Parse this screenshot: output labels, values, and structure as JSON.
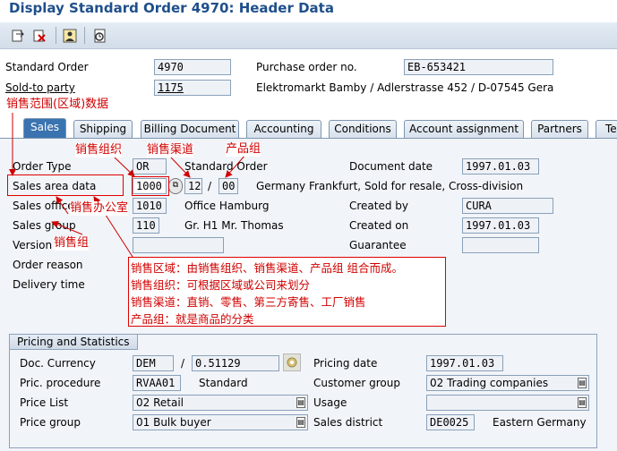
{
  "title": "Display Standard Order 4970: Header Data",
  "header": {
    "standard_order_label": "Standard Order",
    "standard_order_value": "4970",
    "po_label": "Purchase order no.",
    "po_value": "EB-653421",
    "sold_to_label": "Sold-to party",
    "sold_to_value": "1175",
    "sold_to_desc": "Elektromarkt Bamby / Adlerstrasse 452 / D-07545 Gera"
  },
  "tabs": [
    {
      "label": "Sales"
    },
    {
      "label": "Shipping"
    },
    {
      "label": "Billing Document"
    },
    {
      "label": "Accounting"
    },
    {
      "label": "Conditions"
    },
    {
      "label": "Account assignment"
    },
    {
      "label": "Partners"
    },
    {
      "label": "Te"
    }
  ],
  "sales": {
    "order_type_label": "Order Type",
    "order_type_value": "OR",
    "order_type_desc": "Standard Order",
    "doc_date_label": "Document date",
    "doc_date_value": "1997.01.03",
    "sales_area_label": "Sales area data",
    "sales_org": "1000",
    "dist_channel": "12",
    "sep": "/",
    "division": "00",
    "sales_area_desc": "Germany Frankfurt, Sold for resale, Cross-division",
    "sales_office_label": "Sales office",
    "sales_office_value": "1010",
    "sales_office_desc": "Office Hamburg",
    "created_by_label": "Created by",
    "created_by_value": "CURA",
    "sales_group_label": "Sales group",
    "sales_group_value": "110",
    "sales_group_desc": "Gr. H1 Mr. Thomas",
    "created_on_label": "Created on",
    "created_on_value": "1997.01.03",
    "version_label": "Version",
    "guarantee_label": "Guarantee",
    "order_reason_label": "Order reason",
    "delivery_time_label": "Delivery time"
  },
  "pricing": {
    "group_title": "Pricing and Statistics",
    "doc_currency_label": "Doc. Currency",
    "doc_currency_value": "DEM",
    "rate_sep": "/",
    "rate_value": "0.51129",
    "pricing_date_label": "Pricing date",
    "pricing_date_value": "1997.01.03",
    "pric_procedure_label": "Pric. procedure",
    "pric_procedure_value": "RVAA01",
    "pric_procedure_desc": "Standard",
    "customer_group_label": "Customer group",
    "customer_group_value": "02 Trading companies",
    "price_list_label": "Price List",
    "price_list_value": "02 Retail",
    "usage_label": "Usage",
    "usage_value": "",
    "price_group_label": "Price group",
    "price_group_value": "01 Bulk buyer",
    "sales_district_label": "Sales district",
    "sales_district_value": "DE0025",
    "sales_district_desc": "Eastern Germany"
  },
  "annotations": {
    "sales_range": "销售范围(区域)数据",
    "sales_org": "销售组织",
    "dist_channel": "销售渠道",
    "division": "产品组",
    "sales_office": "销售办公室",
    "sales_group": "销售组",
    "note_lines": [
      "销售区域：由销售组织、销售渠道、产品组 组合而成。",
      "销售组织：可根据区域或公司来划分",
      "销售渠道：直销、零售、第三方寄售、工厂销售",
      "产品组：就是商品的分类"
    ]
  },
  "colors": {
    "title": "#1f4f8b",
    "active_tab": "#3b73b0",
    "annotation": "#d00000"
  }
}
